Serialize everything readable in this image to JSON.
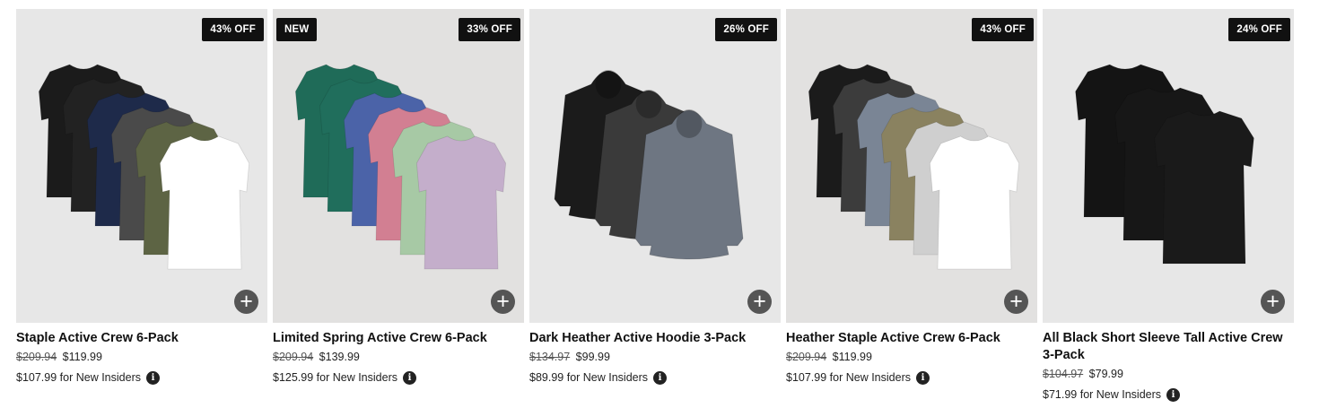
{
  "products": [
    {
      "badges": {
        "new": "",
        "discount": "43% OFF"
      },
      "title": "Staple Active Crew 6-Pack",
      "price_original": "$209.94",
      "price_sale": "$119.99",
      "insider_price": "$107.99",
      "insider_label": "for New Insiders",
      "garment": "tshirt",
      "colors": [
        "#1b1b1b",
        "#222222",
        "#1e2a4a",
        "#4a4a4a",
        "#5d6444",
        "#ffffff"
      ]
    },
    {
      "badges": {
        "new": "NEW",
        "discount": "33% OFF"
      },
      "title": "Limited Spring Active Crew 6-Pack",
      "price_original": "$209.94",
      "price_sale": "$139.99",
      "insider_price": "$125.99",
      "insider_label": "for New Insiders",
      "garment": "tshirt",
      "colors": [
        "#1f6b58",
        "#206e5c",
        "#4b63a8",
        "#d27f92",
        "#a7c9a5",
        "#c4aecb"
      ]
    },
    {
      "badges": {
        "new": "",
        "discount": "26% OFF"
      },
      "title": "Dark Heather Active Hoodie 3-Pack",
      "price_original": "$134.97",
      "price_sale": "$99.99",
      "insider_price": "$89.99",
      "insider_label": "for New Insiders",
      "garment": "hoodie",
      "colors": [
        "#1b1b1b",
        "#3a3a3a",
        "#6e7682"
      ]
    },
    {
      "badges": {
        "new": "",
        "discount": "43% OFF"
      },
      "title": "Heather Staple Active Crew 6-Pack",
      "price_original": "$209.94",
      "price_sale": "$119.99",
      "insider_price": "$107.99",
      "insider_label": "for New Insiders",
      "garment": "tshirt",
      "colors": [
        "#1b1b1b",
        "#3c3c3c",
        "#7a8595",
        "#8a8260",
        "#cfcfcf",
        "#ffffff"
      ]
    },
    {
      "badges": {
        "new": "",
        "discount": "24% OFF"
      },
      "title": "All Black Short Sleeve Tall Active Crew 3-Pack",
      "price_original": "$104.97",
      "price_sale": "$79.99",
      "insider_price": "$71.99",
      "insider_label": "for New Insiders",
      "garment": "tall",
      "colors": [
        "#141414",
        "#171717",
        "#1a1a1a"
      ]
    }
  ],
  "icons": {
    "add": "plus-icon",
    "info": "info-icon"
  }
}
